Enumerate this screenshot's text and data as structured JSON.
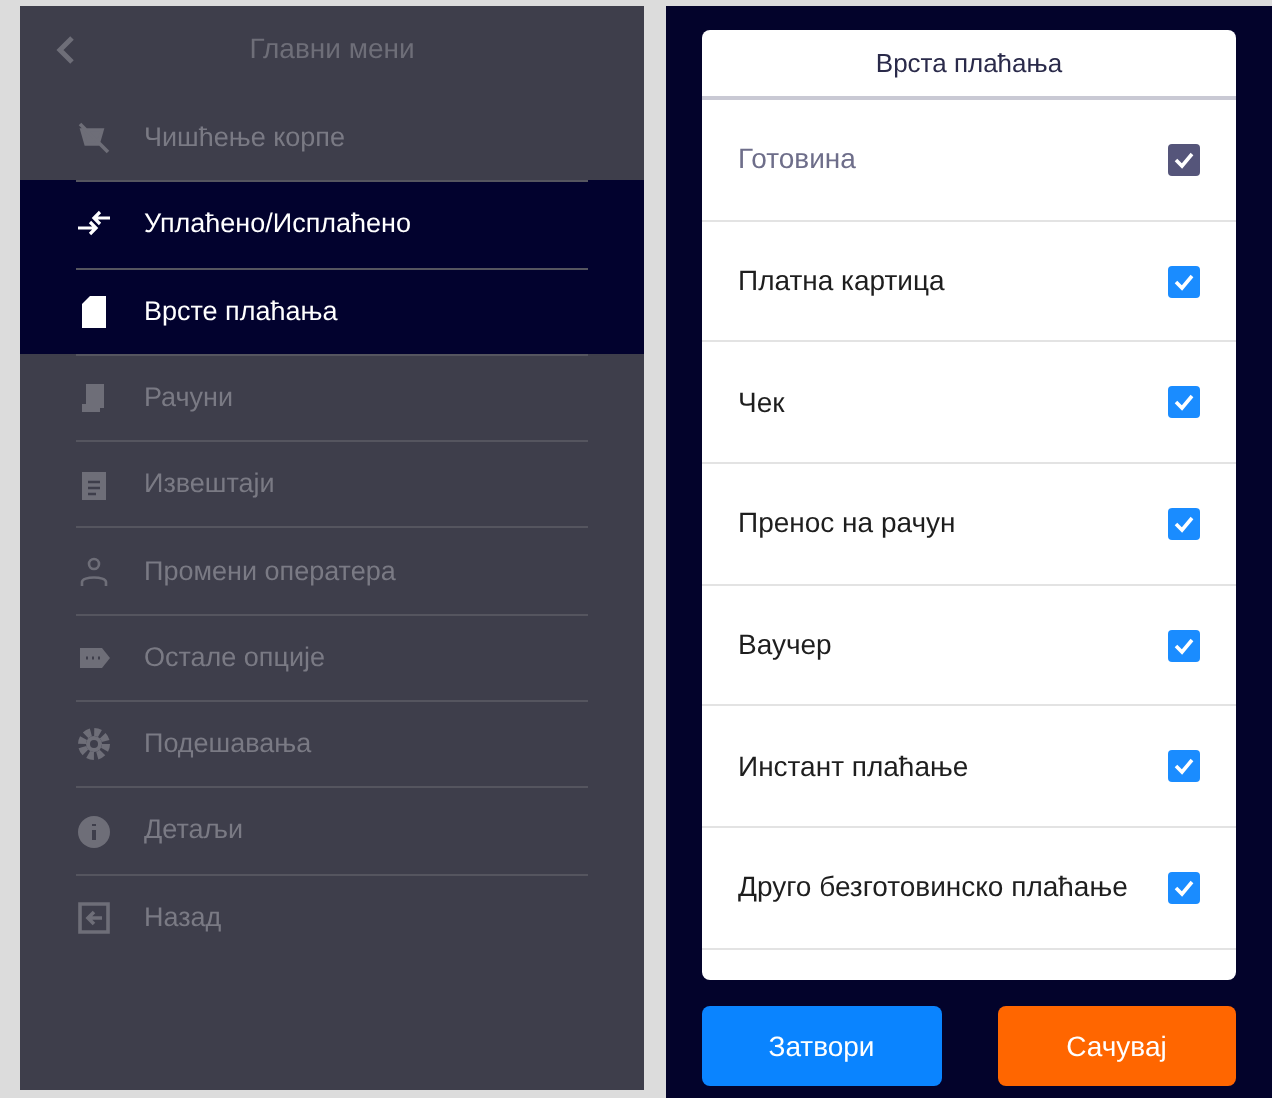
{
  "menu": {
    "title": "Главни мени",
    "items": [
      {
        "kind": "clear-cart",
        "label": "Чишћење корпе",
        "highlighted": false
      },
      {
        "kind": "in-out",
        "label": "Уплаћено/Исплаћено",
        "highlighted": true
      },
      {
        "kind": "payment-types",
        "label": "Врсте плаћања",
        "highlighted": true
      },
      {
        "kind": "receipts",
        "label": "Рачуни",
        "highlighted": false
      },
      {
        "kind": "reports",
        "label": "Извештаји",
        "highlighted": false
      },
      {
        "kind": "operator",
        "label": "Промени оператера",
        "highlighted": false
      },
      {
        "kind": "more",
        "label": "Остале опције",
        "highlighted": false
      },
      {
        "kind": "settings",
        "label": "Подешавања",
        "highlighted": false
      },
      {
        "kind": "info",
        "label": "Детаљи",
        "highlighted": false
      },
      {
        "kind": "back",
        "label": "Назад",
        "highlighted": false
      }
    ]
  },
  "dialog": {
    "title": "Врста плаћања",
    "options": [
      {
        "label": "Готовина",
        "checked": true,
        "disabled": true
      },
      {
        "label": "Платна картица",
        "checked": true,
        "disabled": false
      },
      {
        "label": "Чек",
        "checked": true,
        "disabled": false
      },
      {
        "label": "Пренос на рачун",
        "checked": true,
        "disabled": false
      },
      {
        "label": "Ваучер",
        "checked": true,
        "disabled": false
      },
      {
        "label": "Инстант плаћање",
        "checked": true,
        "disabled": false
      },
      {
        "label": "Друго безготовинско плаћање",
        "checked": true,
        "disabled": false
      }
    ],
    "buttons": [
      {
        "kind": "close",
        "label": "Затвори"
      },
      {
        "kind": "save",
        "label": "Сачувај"
      }
    ]
  }
}
